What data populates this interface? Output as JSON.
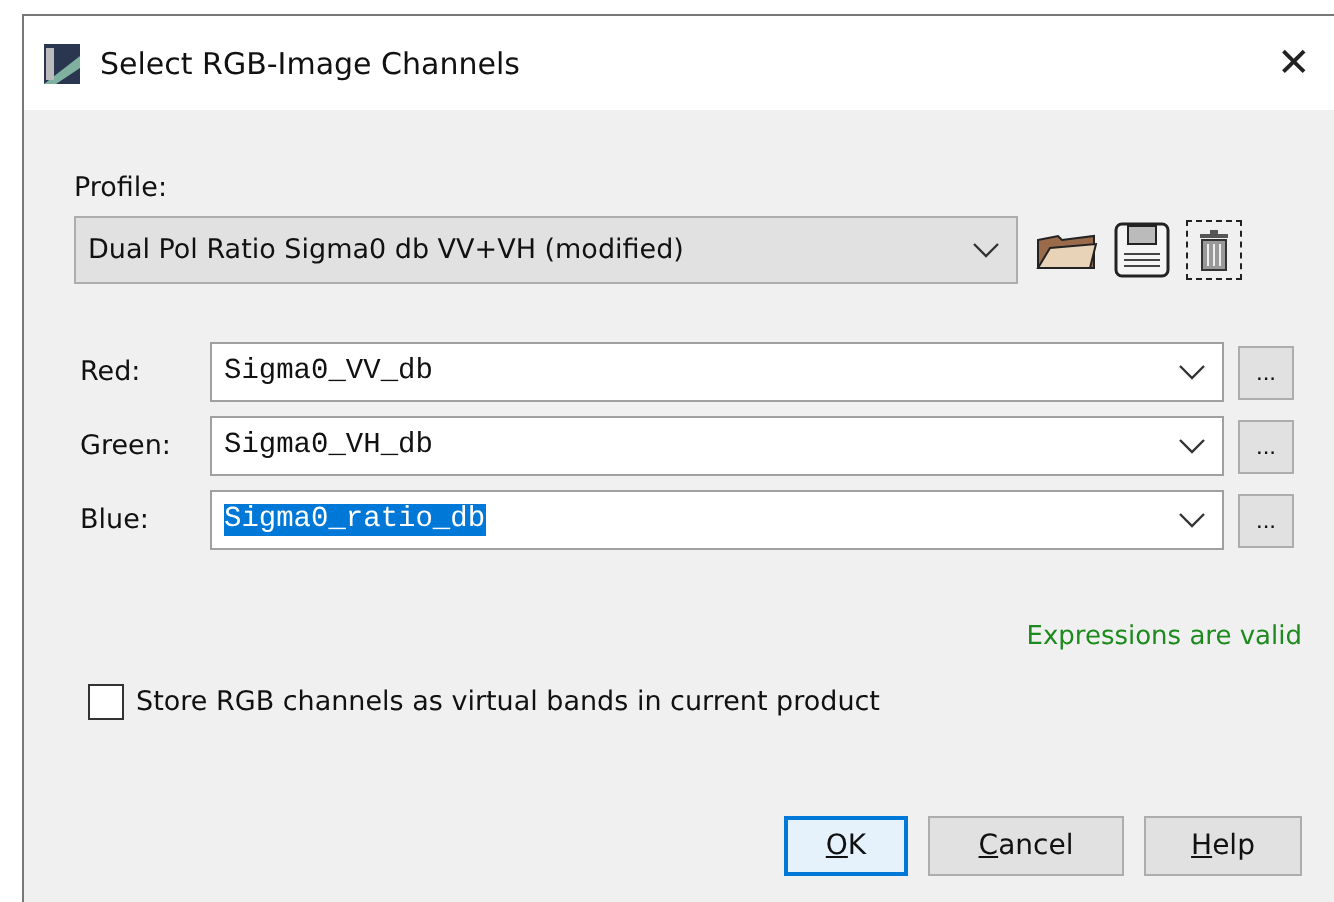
{
  "window": {
    "title": "Select RGB-Image Channels",
    "close": "✕"
  },
  "profile": {
    "label": "Profile:",
    "value": "Dual Pol Ratio Sigma0 db VV+VH (modified)"
  },
  "channels": [
    {
      "label": "Red:",
      "value": "Sigma0_VV_db",
      "highlighted": false,
      "button": "..."
    },
    {
      "label": "Green:",
      "value": "Sigma0_VH_db",
      "highlighted": false,
      "button": "..."
    },
    {
      "label": "Blue:",
      "value": "Sigma0_ratio_db",
      "highlighted": true,
      "button": "..."
    }
  ],
  "status": "Expressions are valid",
  "store_option": {
    "label": "Store RGB channels as virtual bands in current product",
    "checked": false
  },
  "buttons": [
    {
      "label": "OK",
      "default": true
    },
    {
      "label": "Cancel",
      "default": false
    },
    {
      "label": "Help",
      "default": false
    }
  ]
}
